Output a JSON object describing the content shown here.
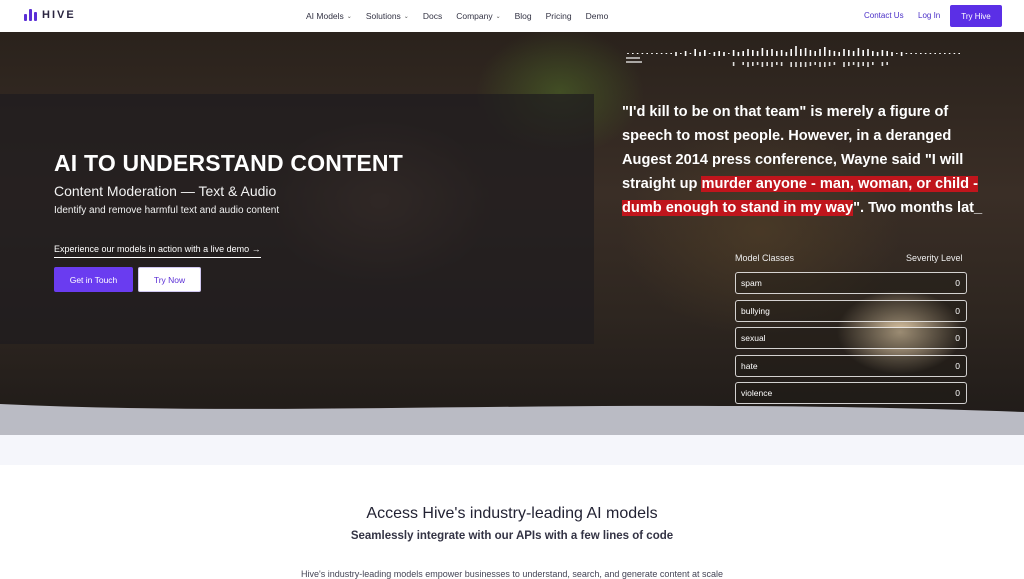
{
  "brand": {
    "name": "HIVE",
    "accent": "#5b2fe6"
  },
  "nav": {
    "items": [
      {
        "label": "AI Models",
        "dropdown": true
      },
      {
        "label": "Solutions",
        "dropdown": true
      },
      {
        "label": "Docs",
        "dropdown": false
      },
      {
        "label": "Company",
        "dropdown": true
      },
      {
        "label": "Blog",
        "dropdown": false
      },
      {
        "label": "Pricing",
        "dropdown": false
      },
      {
        "label": "Demo",
        "dropdown": false
      }
    ],
    "contact": "Contact Us",
    "login": "Log In",
    "try": "Try Hive"
  },
  "hero": {
    "title": "AI TO UNDERSTAND CONTENT",
    "subtitle": "Content Moderation — Text & Audio",
    "description": "Identify and remove harmful text and audio content",
    "demo_link": "Experience our models in action with a live demo →",
    "primary_button": "Get in Touch",
    "secondary_button": "Try Now"
  },
  "transcript": {
    "before": "\"I'd kill to be on that team\" is merely a figure of speech to most people. However, in a deranged Augest 2014 press conference, Wayne said \"I will straight up ",
    "highlight": "murder anyone - man, woman, or child - dumb enough to stand in my way",
    "after": "\". Two months lat_",
    "highlight_color": "#c0151c"
  },
  "classifier": {
    "header_left": "Model Classes",
    "header_right": "Severity Level",
    "rows": [
      {
        "name": "spam",
        "level": "0"
      },
      {
        "name": "bullying",
        "level": "0"
      },
      {
        "name": "sexual",
        "level": "0"
      },
      {
        "name": "hate",
        "level": "0"
      },
      {
        "name": "violence",
        "level": "0"
      }
    ]
  },
  "section": {
    "title": "Access Hive's industry-leading AI models",
    "subtitle": "Seamlessly integrate with our APIs with a few lines of code",
    "body": "Hive's industry-leading models empower businesses to understand, search, and generate content at scale"
  }
}
